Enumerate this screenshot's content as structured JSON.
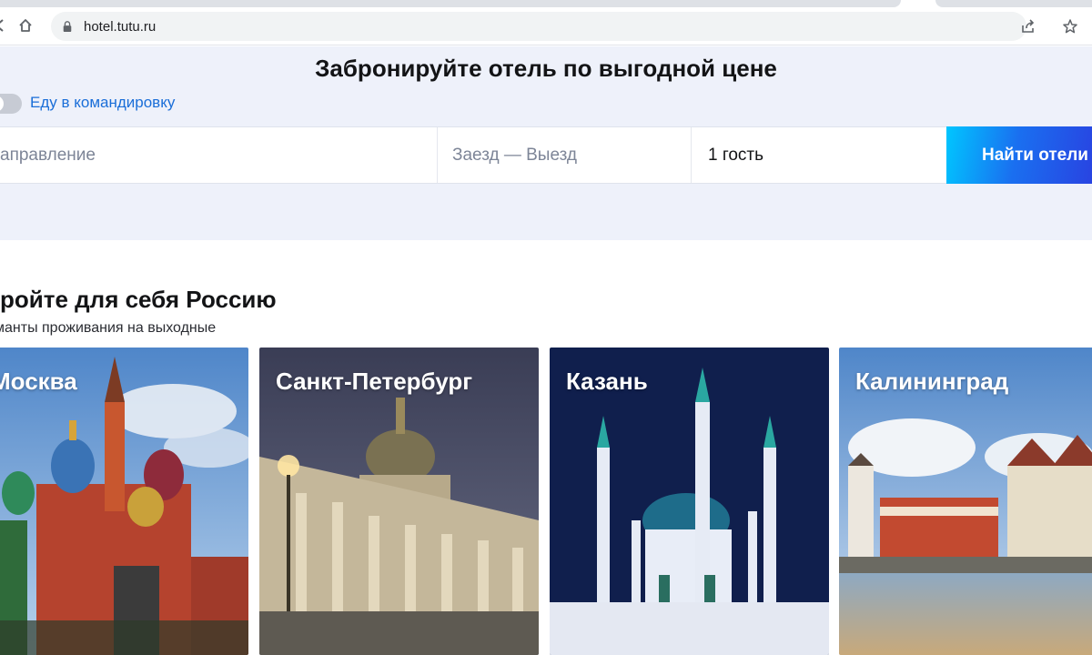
{
  "browser": {
    "url": "hotel.tutu.ru",
    "icons": [
      "back-icon",
      "home-icon",
      "lock-icon",
      "share-icon",
      "star-icon"
    ]
  },
  "hero": {
    "title": "Забронируйте отель по выгодной цене",
    "business_trip_label": "Еду в командировку",
    "business_trip_enabled": false,
    "destination_placeholder": "аправление",
    "dates_placeholder": "Заезд — Выезд",
    "guests_value": "1 гость",
    "search_button_label": "Найти отели"
  },
  "section": {
    "title": "кройте для себя Россию",
    "subtitle": "манты проживания на выходные"
  },
  "cards": [
    {
      "city": "Москва"
    },
    {
      "city": "Санкт-Петербург"
    },
    {
      "city": "Казань"
    },
    {
      "city": "Калининград"
    }
  ],
  "colors": {
    "hero_bg": "#eef1fa",
    "link": "#1a6ed8",
    "button_gradient_start": "#00c6ff",
    "button_gradient_end": "#2a3fe0"
  }
}
